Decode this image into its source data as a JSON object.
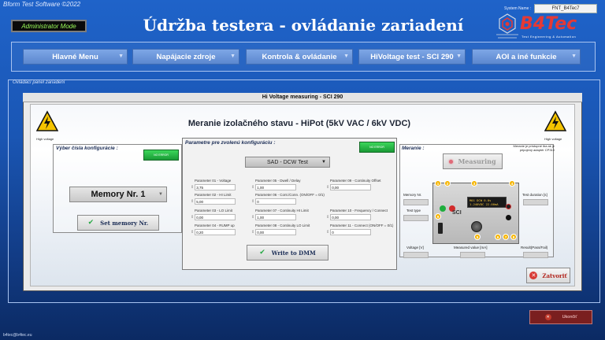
{
  "header": {
    "app_title": "Bform Test Software ©2022",
    "system_name_label": "System Name :",
    "system_name_value": "FNT_B4Tec7",
    "mode_badge": "Administrator Mode",
    "page_title": "Údržba testera - ovládanie zariadení",
    "logo_text": "B4Tec",
    "logo_subtitle": "Test Engineering & Automation"
  },
  "menu": {
    "items": [
      {
        "label": "Hlavné Menu"
      },
      {
        "label": "Napájacie zdroje"
      },
      {
        "label": "Kontrola & ovládanie"
      },
      {
        "label": "HiVoltage test - SCI 290"
      },
      {
        "label": "AOI a iné funkcie"
      }
    ]
  },
  "panel": {
    "label": "Ovládací panel zariadení",
    "dialog_title": "Hi Voltage measuring - SCI 290",
    "section_title": "Meranie izolačného stavu - HiPot (5kV VAC / 6kV VDC)",
    "warning_label": "High voltage"
  },
  "config": {
    "title": "Výber čísla konfigurácie :",
    "error_indicator": "NO ERROR",
    "memory_selected": "Memory Nr. 1",
    "set_button": "Set memory Nr."
  },
  "params": {
    "title": "Parametre pre zvolenú konfiguráciu :",
    "error_indicator": "NO ERROR",
    "mode_selected": "SAD - DCW Test",
    "write_button": "Write to DMM",
    "fields": [
      {
        "label": "Parameter 01 - Voltage",
        "value": "3,75"
      },
      {
        "label": "Parameter 05 - Dwell / Delay",
        "value": "1,00"
      },
      {
        "label": "Parameter 09 - Continuity Offset",
        "value": "0,00"
      },
      {
        "label": "Parameter 02 - HI Limit",
        "value": "5,00"
      },
      {
        "label": "Parameter 06 - Cont./Conn. (ON/OFF = 0/1)",
        "value": "0"
      },
      {
        "label": "Parameter 03 - LO Limit",
        "value": "0,00"
      },
      {
        "label": "Parameter 07 - Continuity HI Limit",
        "value": "1,00"
      },
      {
        "label": "Parameter 10 - Frequency / Connect",
        "value": "0,00"
      },
      {
        "label": "Parameter 04 - RUMP up",
        "value": "0,20"
      },
      {
        "label": "Parameter 08 - Continuity LO Limit",
        "value": "0,00"
      },
      {
        "label": "Parameter 11 - Connect (ON/OFF = 0/1)",
        "value": "0"
      }
    ]
  },
  "measure": {
    "title": "Meranie :",
    "button": "Measuring",
    "note": "Meranie je prístupné iba ak je pripojený adaptér CP310",
    "memory_label": "Memory Nr.",
    "test_type_label": "Test type",
    "test_duration_label": "Test duration [s]",
    "voltage_label": "Voltage [V]",
    "measured_label": "Measured value [mA]",
    "result_label": "Result(Pass/Fail)",
    "device_brand": "SCI",
    "device_screen_line1": "M01 DCW 0.0s",
    "device_screen_line2": "1.240VDC 22.00mA",
    "callouts": [
      "1",
      "2",
      "3",
      "4",
      "5",
      "6",
      "7",
      "8",
      "9"
    ]
  },
  "actions": {
    "close": "Zatvoriť",
    "exit": "Ukončiť"
  },
  "footer": {
    "email": "b4tec@b4tec.eu"
  }
}
